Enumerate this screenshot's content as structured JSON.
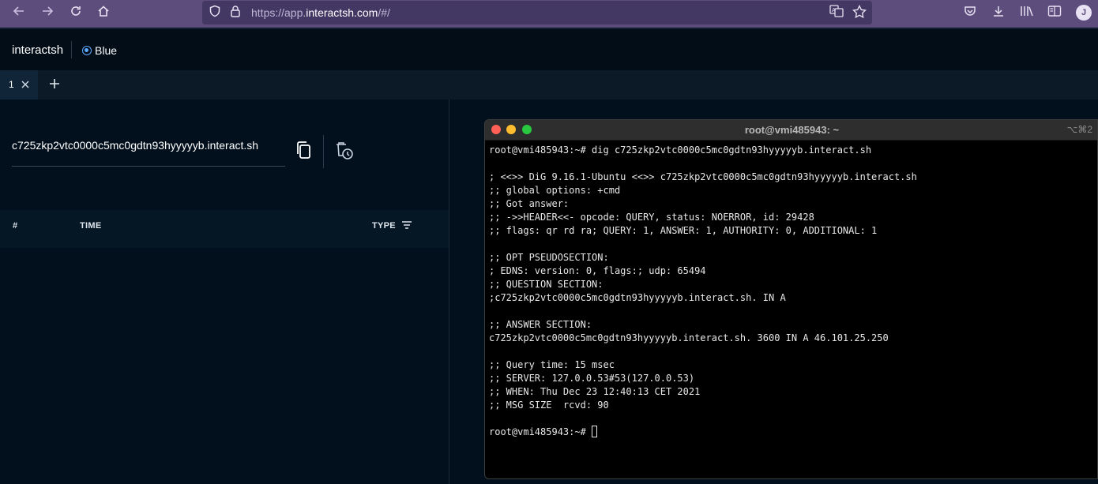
{
  "browser": {
    "url_prefix": "https://app.",
    "url_domain": "interactsh.com",
    "url_suffix": "/#/",
    "profile_initial": "J",
    "icons": [
      "back-arrow-icon",
      "forward-arrow-icon",
      "reload-icon",
      "home-icon",
      "shield-icon",
      "lock-icon",
      "translate-icon",
      "star-icon",
      "pocket-icon",
      "download-icon",
      "library-icon",
      "reader-icon"
    ]
  },
  "app": {
    "brand": "interactsh",
    "theme_label": "Blue"
  },
  "tabs": [
    {
      "label": "1"
    }
  ],
  "left": {
    "domain": "c725zkp2vtc0000c5mc0gdtn93hyyyyyb.interact.sh",
    "columns": {
      "num": "#",
      "time": "TIME",
      "type": "TYPE"
    }
  },
  "terminal": {
    "title": "root@vmi485943: ~",
    "shortcut": "⌥⌘2",
    "lines": [
      "root@vmi485943:~# dig c725zkp2vtc0000c5mc0gdtn93hyyyyyb.interact.sh",
      "",
      "; <<>> DiG 9.16.1-Ubuntu <<>> c725zkp2vtc0000c5mc0gdtn93hyyyyyb.interact.sh",
      ";; global options: +cmd",
      ";; Got answer:",
      ";; ->>HEADER<<- opcode: QUERY, status: NOERROR, id: 29428",
      ";; flags: qr rd ra; QUERY: 1, ANSWER: 1, AUTHORITY: 0, ADDITIONAL: 1",
      "",
      ";; OPT PSEUDOSECTION:",
      "; EDNS: version: 0, flags:; udp: 65494",
      ";; QUESTION SECTION:",
      ";c725zkp2vtc0000c5mc0gdtn93hyyyyyb.interact.sh. IN A",
      "",
      ";; ANSWER SECTION:",
      "c725zkp2vtc0000c5mc0gdtn93hyyyyyb.interact.sh. 3600 IN A 46.101.25.250",
      "",
      ";; Query time: 15 msec",
      ";; SERVER: 127.0.0.53#53(127.0.0.53)",
      ";; WHEN: Thu Dec 23 12:40:13 CET 2021",
      ";; MSG SIZE  rcvd: 90",
      ""
    ],
    "prompt": "root@vmi485943:~# "
  },
  "colors": {
    "browser_chrome": "#5c4d7d",
    "app_background": "#02101d",
    "accent": "#5aa8ff",
    "terminal_bg": "#000000"
  }
}
